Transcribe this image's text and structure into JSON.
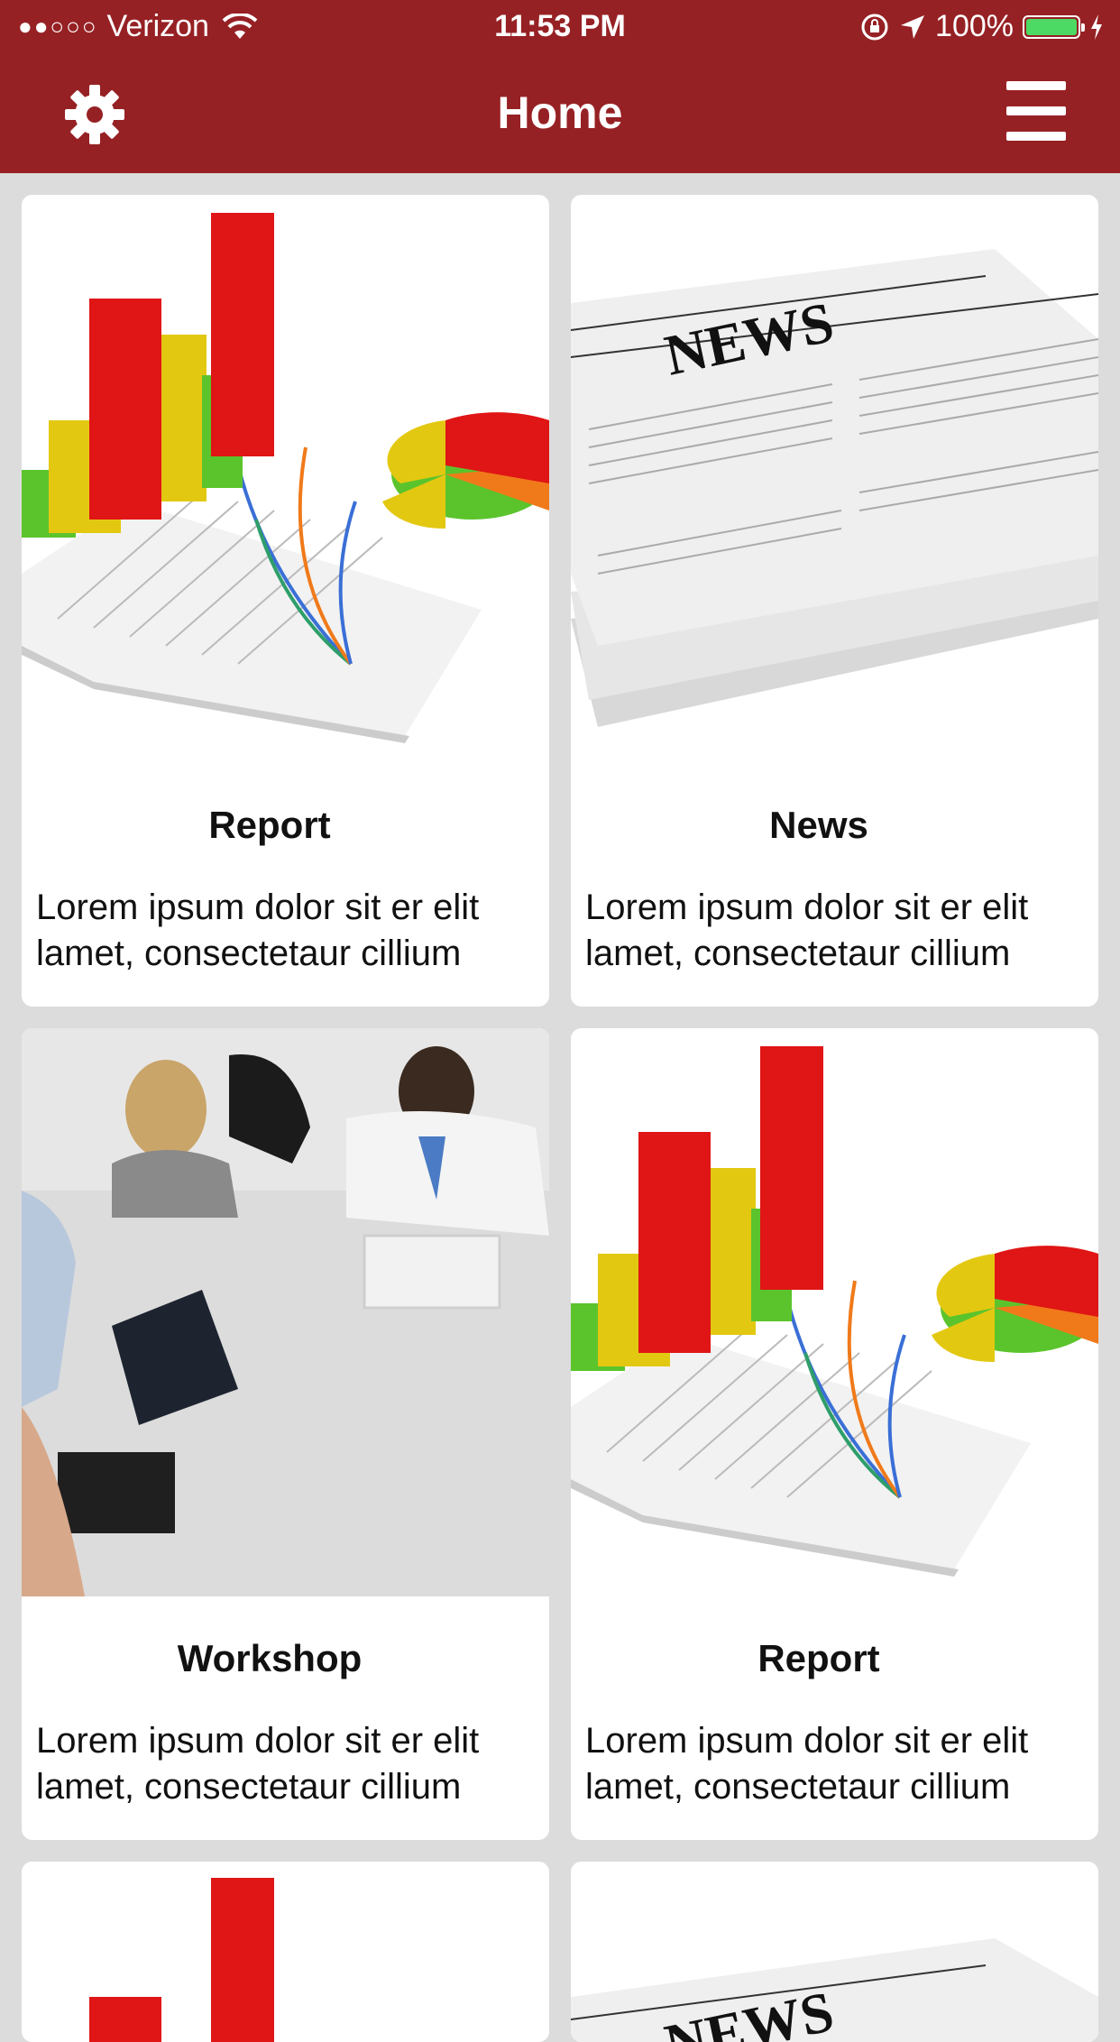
{
  "status_bar": {
    "signal": "●●○○○",
    "carrier": "Verizon",
    "time": "11:53 PM",
    "battery": "100%"
  },
  "header": {
    "title": "Home",
    "settings_icon": "gear-icon",
    "menu_icon": "hamburger-icon",
    "color": "#962124"
  },
  "cards": [
    {
      "title": "Report",
      "description": "Lorem ipsum dolor sit er elit lamet, consectetaur cillium",
      "image": "chart-image"
    },
    {
      "title": "News",
      "description": "Lorem ipsum dolor sit er elit lamet, consectetaur cillium",
      "image": "newspaper-image"
    },
    {
      "title": "Workshop",
      "description": "Lorem ipsum dolor sit er elit lamet, consectetaur cillium",
      "image": "meeting-image"
    },
    {
      "title": "Report",
      "description": "Lorem ipsum dolor sit er elit lamet, consectetaur cillium",
      "image": "chart-image"
    }
  ]
}
